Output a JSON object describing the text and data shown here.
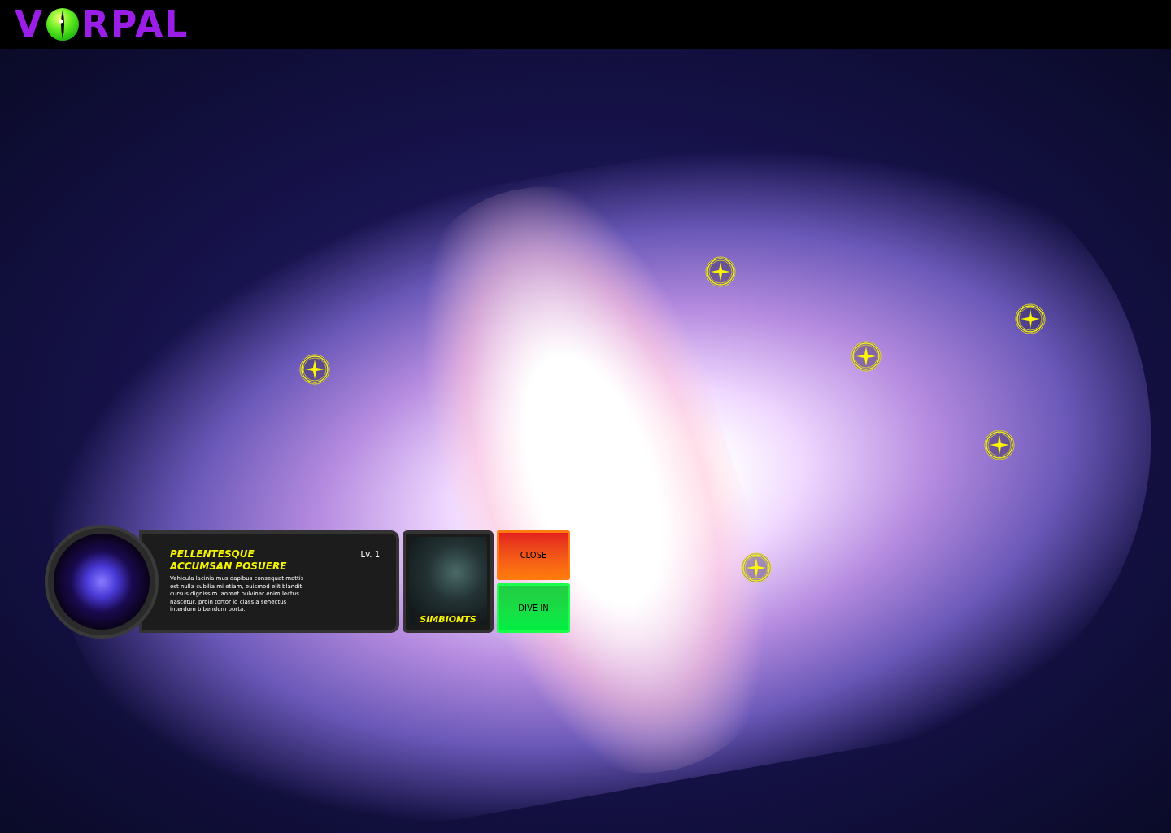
{
  "header": {
    "logo": {
      "first_letter": "V",
      "rest": "RPAL"
    }
  },
  "info_panel": {
    "title": "PELLENTESQUE ACCUMSAN POSUERE",
    "level": "Lv. 1",
    "description": "Vehicula lacinia mus dapibus consequat mattis est nulla cubilia mi etiam, euismod elit blandit cursus dignissim laoreet pulvinar enim lectus nascetur, proin tortor id class a senectus interdum bibendum porta.",
    "category": "SIMBIONTS",
    "buttons": [
      {
        "label": "CLOSE",
        "kind": "close"
      },
      {
        "label": "DIVE IN",
        "kind": "dive"
      }
    ]
  }
}
